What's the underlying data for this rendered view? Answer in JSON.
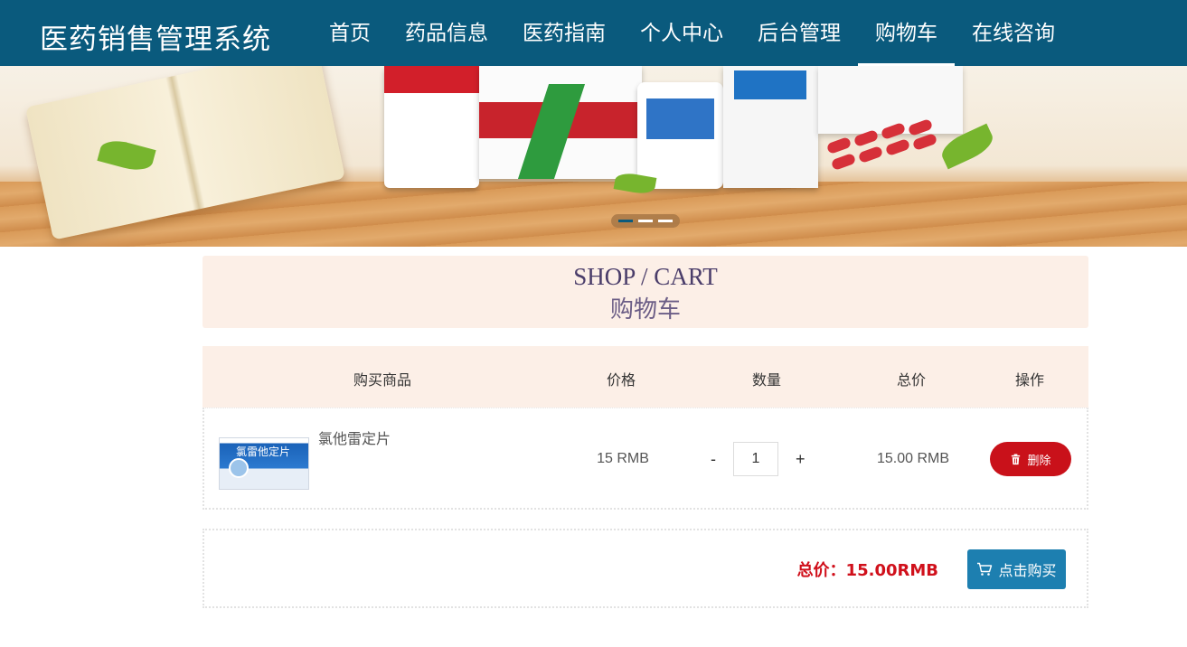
{
  "header": {
    "logo": "医药销售管理系统",
    "nav": [
      {
        "label": "首页",
        "active": false
      },
      {
        "label": "药品信息",
        "active": false
      },
      {
        "label": "医药指南",
        "active": false
      },
      {
        "label": "个人中心",
        "active": false
      },
      {
        "label": "后台管理",
        "active": false
      },
      {
        "label": "购物车",
        "active": true
      },
      {
        "label": "在线咨询",
        "active": false
      }
    ],
    "bg_color": "#0a5a7d"
  },
  "banner": {
    "slides_count": 3,
    "active_slide": 1
  },
  "page_title": {
    "en": "SHOP / CART",
    "cn": "购物车"
  },
  "cart_table": {
    "columns": [
      "购买商品",
      "价格",
      "数量",
      "总价",
      "操作"
    ],
    "rows": [
      {
        "product_name": "氯他雷定片",
        "thumb_label": "氯雷他定片",
        "price": "15 RMB",
        "quantity": "1",
        "subtotal": "15.00 RMB",
        "delete_label": "删除"
      }
    ],
    "qty_minus": "-",
    "qty_plus": "+"
  },
  "summary": {
    "total": "总价：15.00RMB",
    "buy_label": "点击购买",
    "total_color": "#d0101b",
    "button_color": "#1d7fb0"
  }
}
